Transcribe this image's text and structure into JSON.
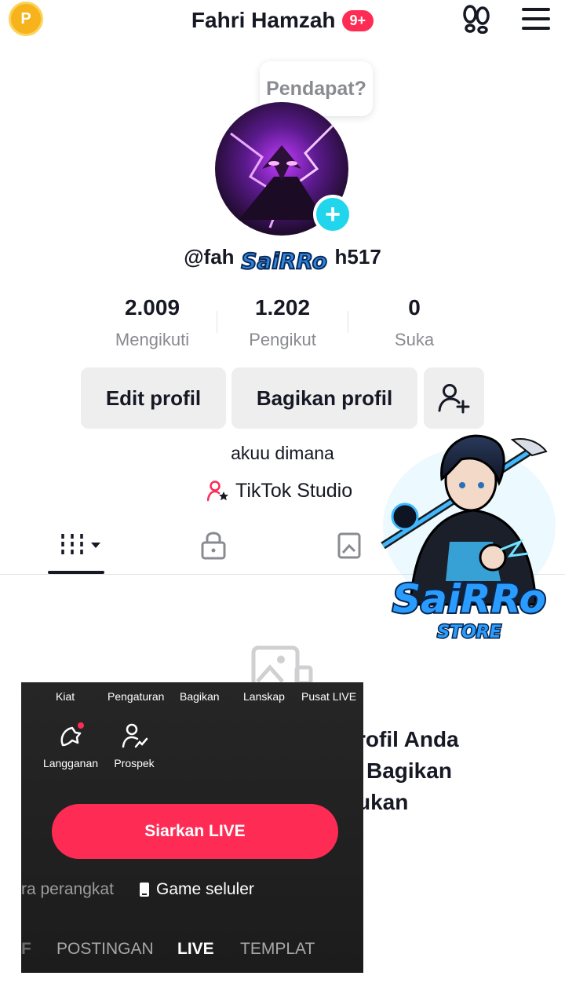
{
  "header": {
    "coin_letter": "P",
    "title": "Fahri Hamzah",
    "notification_badge": "9+"
  },
  "tooltip": {
    "text": "Pendapat?"
  },
  "profile": {
    "username": "@fah h517",
    "username_left": "@fah",
    "username_right": "h517",
    "watermark_small": "SaiRRo",
    "stats": [
      {
        "value": "2.009",
        "label": "Mengikuti"
      },
      {
        "value": "1.202",
        "label": "Pengikut"
      },
      {
        "value": "0",
        "label": "Suka"
      }
    ],
    "buttons": {
      "edit": "Edit profil",
      "share": "Bagikan profil"
    },
    "bio": "akuu dimana",
    "studio_link": "TikTok Studio"
  },
  "empty_state": {
    "line1": "rofil Anda",
    "line2": "Bagikan",
    "line3": "ukan"
  },
  "watermark": {
    "line1": "SaiRRo",
    "line2": "STORE"
  },
  "live_panel": {
    "tools_row1": [
      "Kiat",
      "Pengaturan",
      "Bagikan",
      "Lanskap",
      "Pusat LIVE"
    ],
    "tools_row2": [
      "Langganan",
      "Prospek"
    ],
    "primary_button": "Siarkan LIVE",
    "modes": {
      "left": "ra perangkat",
      "right": "Game seluler"
    },
    "bottom_tabs": {
      "partial": "F",
      "posting": "POSTINGAN",
      "live": "LIVE",
      "template": "TEMPLAT"
    }
  },
  "colors": {
    "accent_red": "#fe2c55",
    "accent_cyan": "#20d5ec",
    "coin": "#f6b31b",
    "text_secondary": "#8a8b91"
  }
}
